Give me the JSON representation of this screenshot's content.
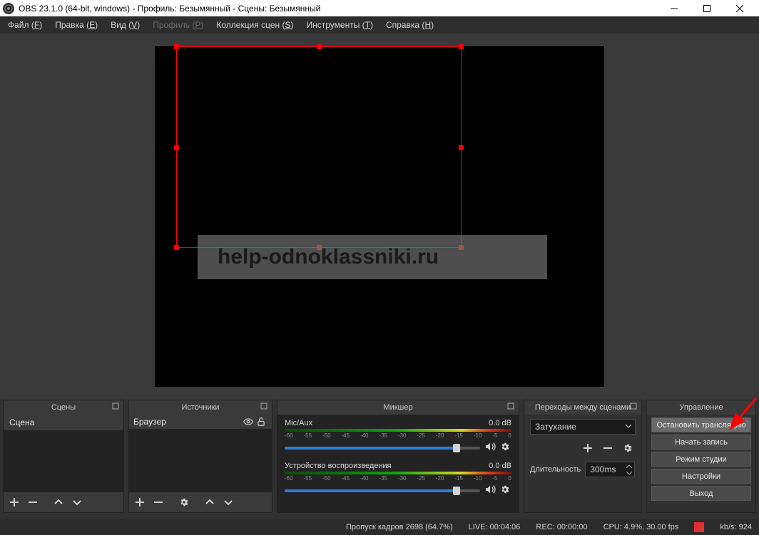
{
  "titlebar": {
    "title": "OBS 23.1.0 (64-bit, windows) - Профиль: Безымянный - Сцены: Безымянный"
  },
  "menu": {
    "file": "Файл",
    "file_mn": "F",
    "edit": "Правка",
    "edit_mn": "E",
    "view": "Вид",
    "view_mn": "V",
    "profile": "Профиль",
    "profile_mn": "P",
    "scenes": "Коллекция сцен",
    "scenes_mn": "S",
    "tools": "Инструменты",
    "tools_mn": "T",
    "help": "Справка",
    "help_mn": "H"
  },
  "preview": {
    "watermark": "help-odnoklassniki.ru"
  },
  "docks": {
    "scenes": {
      "title": "Сцены",
      "item": "Сцена"
    },
    "sources": {
      "title": "Источники",
      "item": "Браузер"
    },
    "mixer": {
      "title": "Микшер",
      "ch1_name": "Mic/Aux",
      "ch1_db": "0.0 dB",
      "ch2_name": "Устройство воспроизведения",
      "ch2_db": "0.0 dB",
      "ticks": [
        "-60",
        "-55",
        "-50",
        "-45",
        "-40",
        "-35",
        "-30",
        "-25",
        "-20",
        "-15",
        "-10",
        "-5",
        "0"
      ]
    },
    "transitions": {
      "title": "Переходы между сценами",
      "type": "Затухание",
      "duration_label": "Длительность",
      "duration_value": "300ms"
    },
    "controls": {
      "title": "Управление",
      "stop_stream": "Остановить трансляцию",
      "start_record": "Начать запись",
      "studio_mode": "Режим студии",
      "settings": "Настройки",
      "exit": "Выход"
    }
  },
  "status": {
    "drops": "Пропуск кадров 2698 (64.7%)",
    "live": "LIVE: 00:04:06",
    "rec": "REC: 00:00:00",
    "cpu": "CPU: 4.9%, 30.00 fps",
    "kbps": "kb/s: 924"
  }
}
